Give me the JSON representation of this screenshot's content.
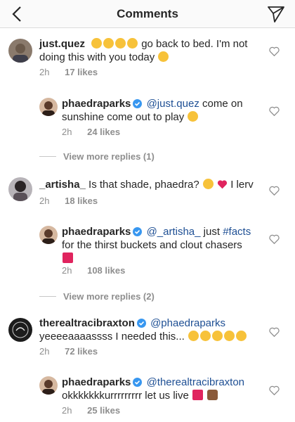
{
  "header": {
    "title": "Comments"
  },
  "comments": [
    {
      "user": "just.quez",
      "verified": false,
      "line1": "go back to bed. I'm not",
      "line2": "doing this with you today",
      "time": "2h",
      "likes": "17 likes",
      "emojis": [
        "joy",
        "joy",
        "joy",
        "joy"
      ]
    },
    {
      "user": "phaedraparks",
      "verified": true,
      "mention": "@just.quez",
      "line1": "come on",
      "line2": "sunshine come out to play",
      "time": "2h",
      "likes": "24 likes"
    },
    {
      "user": "_artisha_",
      "verified": false,
      "line1": "Is that shade, phaedra?",
      "line2": "I lerv",
      "time": "2h",
      "likes": "18 likes"
    },
    {
      "user": "phaedraparks",
      "verified": true,
      "mention": "@_artisha_",
      "line1": "just",
      "hashtag": "#facts",
      "line2": "for the thirst buckets and clout chasers",
      "time": "2h",
      "likes": "108 likes"
    },
    {
      "user": "therealtracibraxton",
      "verified": true,
      "mention": "@phaedraparks",
      "line1": "yeeeeaaaassss I needed this...",
      "time": "2h",
      "likes": "72 likes"
    },
    {
      "user": "phaedraparks",
      "verified": true,
      "mention": "@therealtracibraxton",
      "line1": "okkkkkkkurrrrrrrrr let us live",
      "time": "2h",
      "likes": "25 likes"
    }
  ],
  "view_more": [
    "View more replies (1)",
    "View more replies (2)"
  ],
  "colors": {
    "mention": "#1e4f94",
    "verified": "#3897f0",
    "meta": "#8e8e8e",
    "emoji": "#f7c23a",
    "heart_emoji": "#e0245e"
  }
}
